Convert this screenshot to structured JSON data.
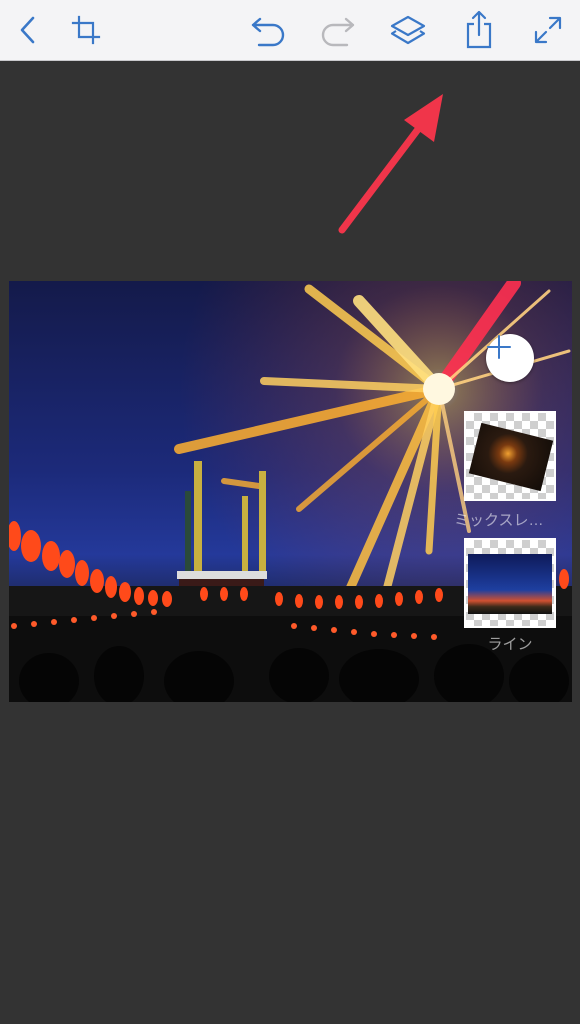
{
  "toolbar": {
    "buttons": [
      {
        "id": "back",
        "icon": "chevron-left-icon",
        "enabled": true
      },
      {
        "id": "crop",
        "icon": "crop-icon",
        "enabled": true
      },
      {
        "id": "undo",
        "icon": "undo-icon",
        "enabled": true
      },
      {
        "id": "redo",
        "icon": "redo-icon",
        "enabled": false
      },
      {
        "id": "layers",
        "icon": "layers-icon",
        "enabled": true
      },
      {
        "id": "share",
        "icon": "share-icon",
        "enabled": true
      },
      {
        "id": "fullscreen",
        "icon": "expand-icon",
        "enabled": true
      }
    ],
    "accent_color": "#3a78c8",
    "disabled_color": "#b8b8bc"
  },
  "annotation": {
    "icon": "red-arrow-icon",
    "color": "#f0354a"
  },
  "canvas": {
    "description_color_sky": "#1c2a7a"
  },
  "layers_panel": {
    "add_button_icon": "plus-icon",
    "layers": [
      {
        "label": "ミックスレ…",
        "thumb": "fireworks-cutout"
      },
      {
        "label": "ライン",
        "thumb": "festival-photo"
      }
    ]
  }
}
